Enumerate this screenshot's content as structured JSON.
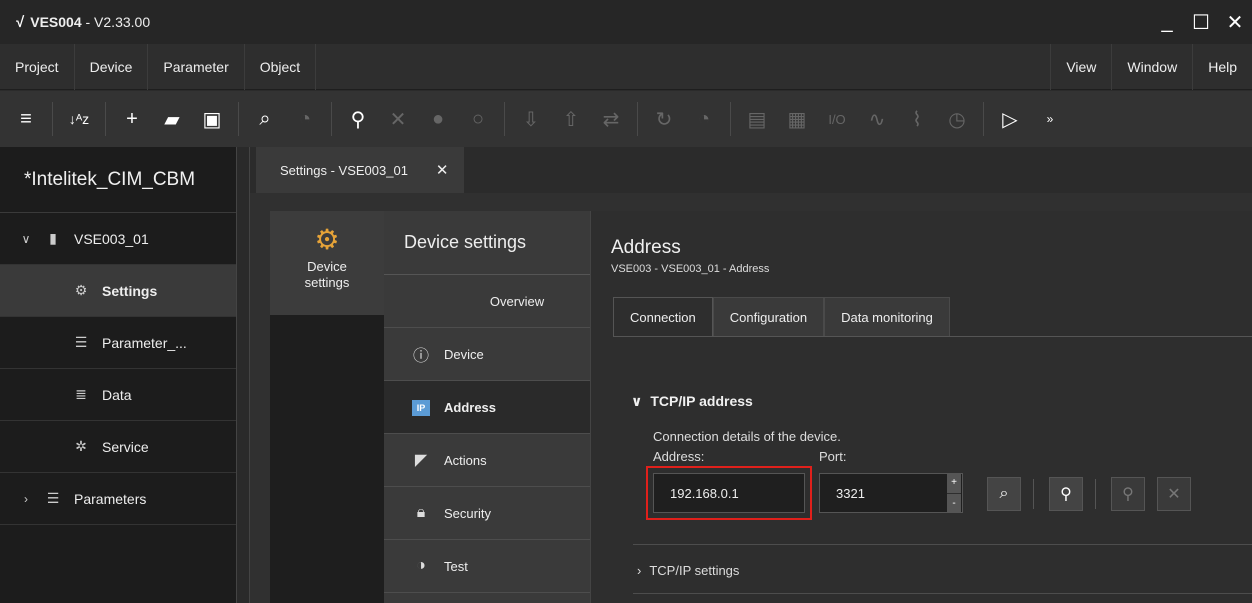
{
  "window": {
    "app_name": "VES004",
    "version": " - V2.33.00",
    "minimize": "_",
    "maximize": "☐",
    "close": "✕"
  },
  "menu": {
    "left": [
      "Project",
      "Device",
      "Parameter",
      "Object"
    ],
    "right": [
      "View",
      "Window",
      "Help"
    ]
  },
  "toolbar": {
    "icons": [
      "menu-icon",
      "sort-icon",
      "add-icon",
      "open-folder-icon",
      "save-icon",
      "search-icon",
      "scan-icon",
      "connect-icon",
      "disconnect-icon",
      "user-icon",
      "user-outline-icon",
      "download-icon",
      "upload-icon",
      "compare-icon",
      "refresh-icon",
      "scan2-icon",
      "chart-icon",
      "display-icon",
      "io-icon",
      "signal-icon",
      "pulse-icon",
      "clock-icon",
      "play-icon"
    ]
  },
  "sidebar": {
    "project": "*Intelitek_CIM_CBM",
    "device": "VSE003_01",
    "children": [
      {
        "label": "Settings",
        "icon": "gear-icon"
      },
      {
        "label": "Parameter_...",
        "icon": "sliders-icon"
      },
      {
        "label": "Data",
        "icon": "database-icon"
      },
      {
        "label": "Service",
        "icon": "gears-icon"
      }
    ],
    "parameters": "Parameters"
  },
  "doc_tab": {
    "label": "Settings - VSE003_01",
    "close": "✕"
  },
  "category": {
    "label1": "Device",
    "label2": "settings"
  },
  "sections": {
    "header": "Device settings",
    "items": [
      {
        "label": "Overview"
      },
      {
        "label": "Device",
        "icon": "info-icon"
      },
      {
        "label": "Address",
        "icon": "ip-icon",
        "badge": "IP"
      },
      {
        "label": "Actions",
        "icon": "flag-icon"
      },
      {
        "label": "Security",
        "icon": "lock-icon"
      },
      {
        "label": "Test",
        "icon": "test-icon"
      }
    ]
  },
  "main": {
    "title": "Address",
    "breadcrumb": "VSE003 - VSE003_01 - Address",
    "tabs": [
      "Connection",
      "Configuration",
      "Data monitoring"
    ],
    "group_title": "TCP/IP address",
    "group_desc": "Connection details of the device.",
    "address_label": "Address:",
    "port_label": "Port:",
    "address_value": "192.168.0.1",
    "port_value": "3321",
    "spin_up": "+",
    "spin_down": "-",
    "subgroup": "TCP/IP settings"
  },
  "colors": {
    "highlight": "#e0201b",
    "accent_gear": "#e6a338",
    "ip_badge": "#5b9bd5"
  }
}
